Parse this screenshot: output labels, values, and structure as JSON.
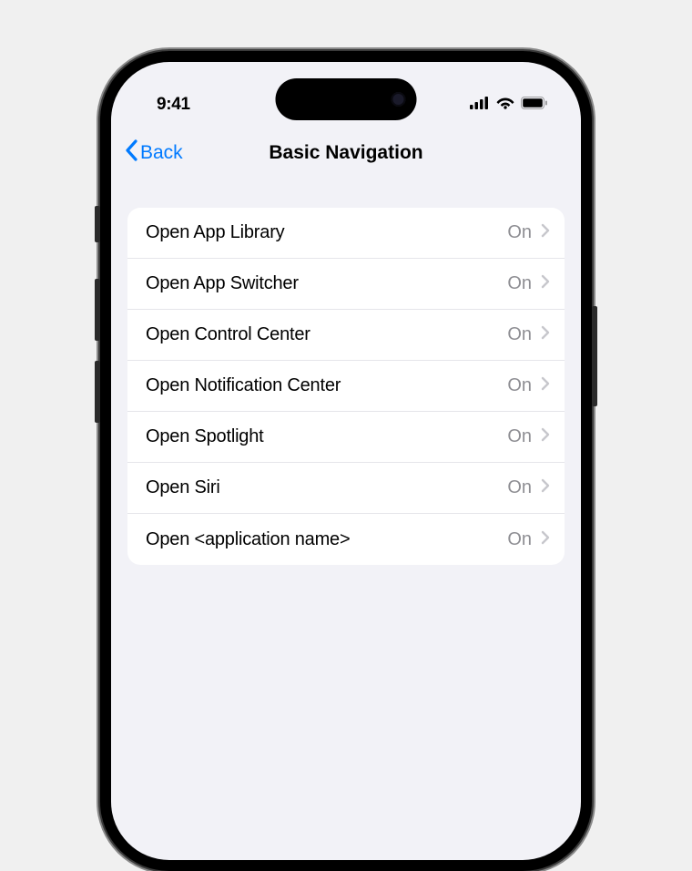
{
  "status_bar": {
    "time": "9:41"
  },
  "nav": {
    "back_label": "Back",
    "title": "Basic Navigation"
  },
  "settings": {
    "rows": [
      {
        "label": "Open App Library",
        "value": "On"
      },
      {
        "label": "Open App Switcher",
        "value": "On"
      },
      {
        "label": "Open Control Center",
        "value": "On"
      },
      {
        "label": "Open Notification Center",
        "value": "On"
      },
      {
        "label": "Open Spotlight",
        "value": "On"
      },
      {
        "label": "Open Siri",
        "value": "On"
      },
      {
        "label": "Open <application name>",
        "value": "On"
      }
    ]
  },
  "colors": {
    "link": "#007aff",
    "secondary": "#8e8e93",
    "separator": "#e5e5ea",
    "background": "#f2f2f7"
  }
}
